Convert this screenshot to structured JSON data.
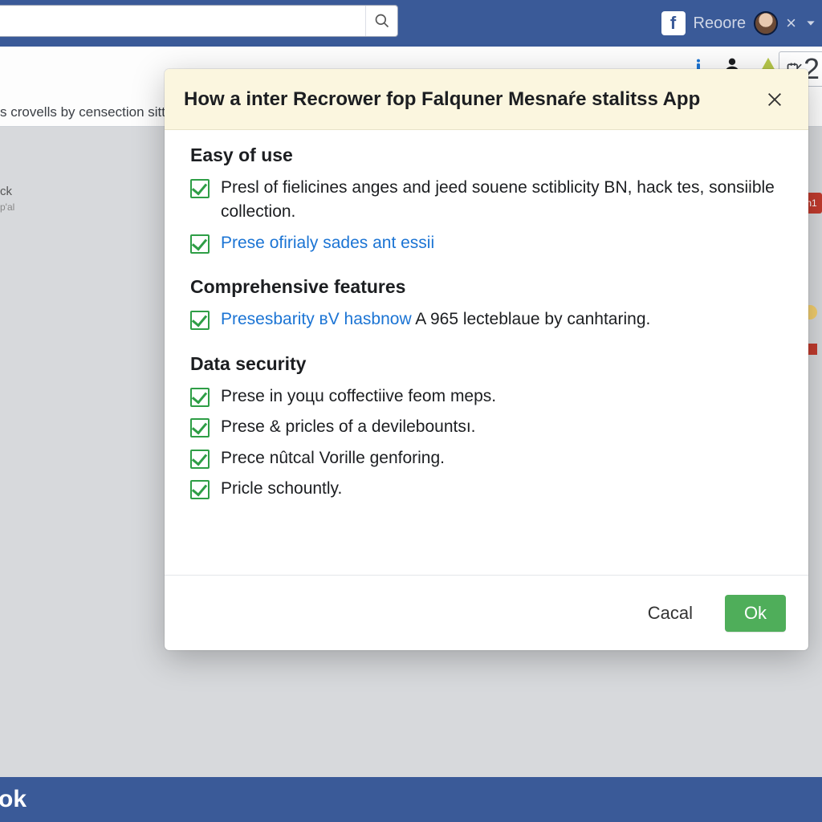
{
  "topbar": {
    "search_value": "",
    "reoore_label": "Reoore",
    "close_glyph": "×",
    "fb_letter": "f",
    "badge_count": "2"
  },
  "strip": {
    "crumb": "s crovells by censection sitt"
  },
  "side": {
    "l1": "ck",
    "l2": "p'al"
  },
  "edge": {
    "red_label": "n1"
  },
  "bottom": {
    "text": "ok"
  },
  "modal": {
    "title": "How a inter Recrower foр Falquner Mesnaŕe stalitss App",
    "sections": [
      {
        "heading": "Easy of use",
        "items": [
          {
            "style": "plain",
            "text": "Presl of fielicines anges and jeed souene sctiblicity BN, hack tes, sonsiible collection."
          },
          {
            "style": "link",
            "text": "Prese ofirialy sades ant essii"
          }
        ]
      },
      {
        "heading": "Comprehensive features",
        "items": [
          {
            "style": "mixed",
            "link_part": "Presesbarity вV hasbnow",
            "rest_part": " A 965 lecteblaue by canhtaring."
          }
        ]
      },
      {
        "heading": "Data security",
        "items": [
          {
            "style": "plain",
            "text": "Prese in yoцu coffectiive feom meps."
          },
          {
            "style": "plain",
            "text": "Prese & pricles of a devilebountsı."
          },
          {
            "style": "plain",
            "text": "Prece nûtcal Vorille genforing."
          },
          {
            "style": "plain",
            "text": "Pricle schountly."
          }
        ]
      }
    ],
    "footer": {
      "cancel": "Cacal",
      "ok": "Ok"
    }
  }
}
